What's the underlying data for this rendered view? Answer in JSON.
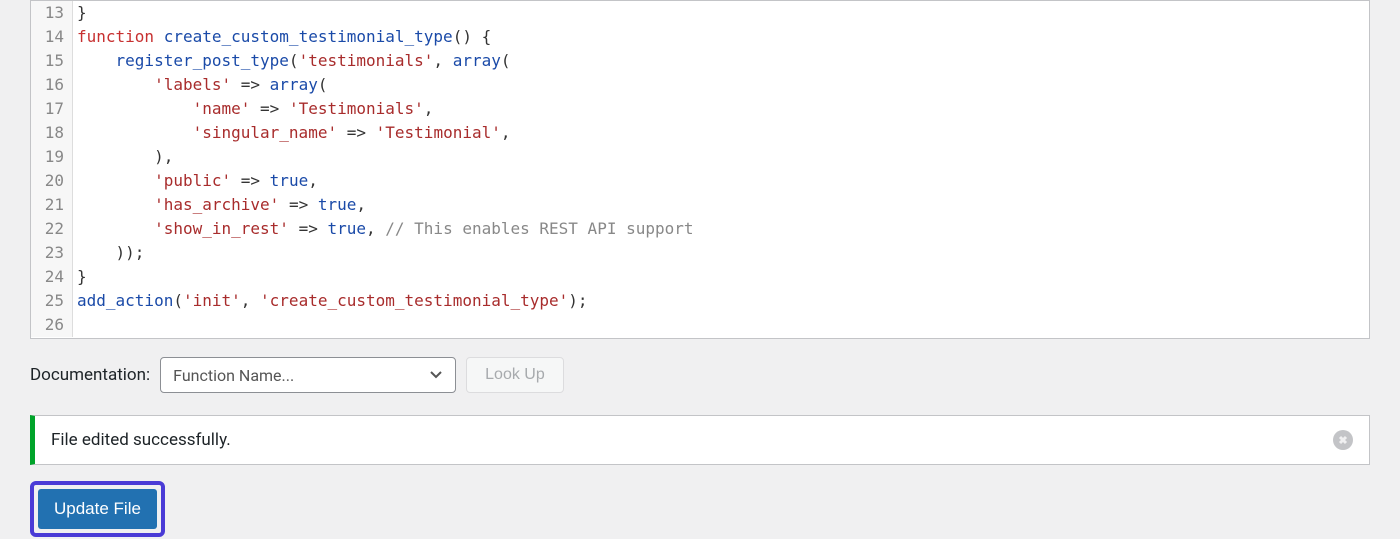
{
  "code_lines": [
    {
      "n": "13",
      "html": "<span class='tok-plain'>}</span>"
    },
    {
      "n": "14",
      "html": "<span class='tok-keyword'>function</span> <span class='tok-funcname'>create_custom_testimonial_type</span><span class='tok-plain'>() {</span>"
    },
    {
      "n": "15",
      "html": "    <span class='tok-func'>register_post_type</span><span class='tok-plain'>(</span><span class='tok-string'>'testimonials'</span><span class='tok-plain'>, </span><span class='tok-func'>array</span><span class='tok-plain'>(</span>"
    },
    {
      "n": "16",
      "html": "        <span class='tok-string'>'labels'</span> <span class='tok-arrow'>=></span> <span class='tok-func'>array</span><span class='tok-plain'>(</span>"
    },
    {
      "n": "17",
      "html": "            <span class='tok-string'>'name'</span> <span class='tok-arrow'>=></span> <span class='tok-string'>'Testimonials'</span><span class='tok-plain'>,</span>"
    },
    {
      "n": "18",
      "html": "            <span class='tok-string'>'singular_name'</span> <span class='tok-arrow'>=></span> <span class='tok-string'>'Testimonial'</span><span class='tok-plain'>,</span>"
    },
    {
      "n": "19",
      "html": "        <span class='tok-plain'>),</span>"
    },
    {
      "n": "20",
      "html": "        <span class='tok-string'>'public'</span> <span class='tok-arrow'>=></span> <span class='tok-bool'>true</span><span class='tok-plain'>,</span>"
    },
    {
      "n": "21",
      "html": "        <span class='tok-string'>'has_archive'</span> <span class='tok-arrow'>=></span> <span class='tok-bool'>true</span><span class='tok-plain'>,</span>"
    },
    {
      "n": "22",
      "html": "        <span class='tok-string'>'show_in_rest'</span> <span class='tok-arrow'>=></span> <span class='tok-bool'>true</span><span class='tok-plain'>, </span><span class='tok-comment'>// This enables REST API support</span>"
    },
    {
      "n": "23",
      "html": "    <span class='tok-plain'>));</span>"
    },
    {
      "n": "24",
      "html": "<span class='tok-plain'>}</span>"
    },
    {
      "n": "25",
      "html": "<span class='tok-func'>add_action</span><span class='tok-plain'>(</span><span class='tok-string'>'init'</span><span class='tok-plain'>, </span><span class='tok-string'>'create_custom_testimonial_type'</span><span class='tok-plain'>);</span>"
    },
    {
      "n": "26",
      "html": ""
    }
  ],
  "doc": {
    "label": "Documentation:",
    "select_placeholder": "Function Name...",
    "lookup_label": "Look Up"
  },
  "notice": {
    "message": "File edited successfully."
  },
  "update_button": {
    "label": "Update File"
  }
}
